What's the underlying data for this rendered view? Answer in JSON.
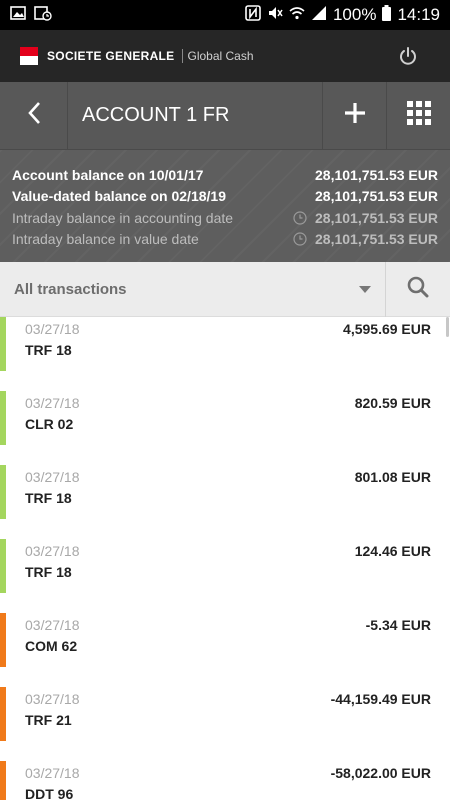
{
  "statusbar": {
    "battery": "100%",
    "time": "14:19",
    "icons": [
      "image-icon",
      "calendar-clock-icon",
      "nfc-icon",
      "mute-icon",
      "wifi-icon",
      "signal-icon",
      "battery-icon"
    ]
  },
  "header": {
    "brand": "SOCIETE GENERALE",
    "product": "Global Cash",
    "logo_colors": [
      "#e3001b",
      "#ffffff"
    ]
  },
  "account": {
    "title": "ACCOUNT 1 FR"
  },
  "balances": [
    {
      "label": "Account balance on 10/01/17",
      "value": "28,101,751.53 EUR",
      "style": "strong"
    },
    {
      "label": "Value-dated balance on 02/18/19",
      "value": "28,101,751.53 EUR",
      "style": "strong"
    },
    {
      "label": "Intraday balance in  accounting date",
      "value": "28,101,751.53 EUR",
      "style": "dim"
    },
    {
      "label": "Intraday balance in  value date",
      "value": "28,101,751.53 EUR",
      "style": "dim"
    }
  ],
  "filter": {
    "label": "All transactions"
  },
  "colors": {
    "credit": "#a4d65e",
    "debit": "#f07a1a"
  },
  "transactions": [
    {
      "date": "03/27/18",
      "code": "TRF 18",
      "amount": "4,595.69 EUR",
      "type": "credit"
    },
    {
      "date": "03/27/18",
      "code": "CLR 02",
      "amount": "820.59 EUR",
      "type": "credit"
    },
    {
      "date": "03/27/18",
      "code": "TRF 18",
      "amount": "801.08 EUR",
      "type": "credit"
    },
    {
      "date": "03/27/18",
      "code": "TRF 18",
      "amount": "124.46 EUR",
      "type": "credit"
    },
    {
      "date": "03/27/18",
      "code": "COM 62",
      "amount": "-5.34 EUR",
      "type": "debit"
    },
    {
      "date": "03/27/18",
      "code": "TRF 21",
      "amount": "-44,159.49 EUR",
      "type": "debit"
    },
    {
      "date": "03/27/18",
      "code": "DDT 96",
      "amount": "-58,022.00 EUR",
      "type": "debit"
    }
  ]
}
